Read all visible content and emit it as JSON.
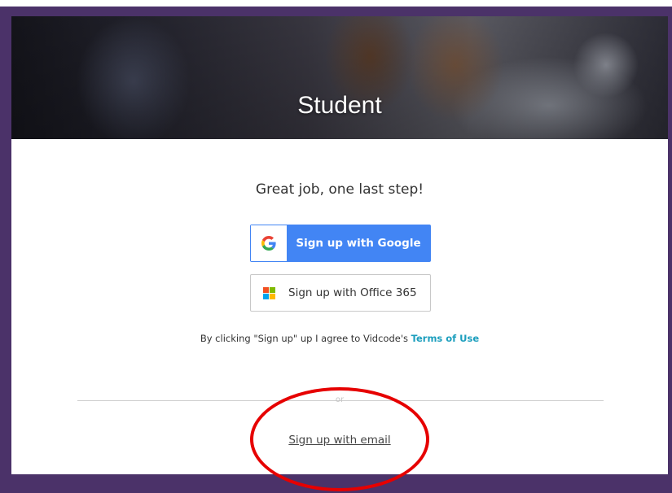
{
  "hero": {
    "title": "Student"
  },
  "signup": {
    "heading": "Great job, one last step!",
    "google_label": "Sign up with Google",
    "office_label": "Sign up with Office 365",
    "terms_prefix": "By clicking \"Sign up\" up I agree to Vidcode's ",
    "terms_link": "Terms of Use",
    "or_text": "or",
    "email_link": "Sign up with email"
  },
  "icons": {
    "google": "google-g-icon",
    "office": "microsoft-logo-icon"
  },
  "colors": {
    "frame": "#4b3269",
    "google_blue": "#4285f4",
    "terms_link": "#1b9ebd",
    "annotation_circle": "#e60000"
  }
}
